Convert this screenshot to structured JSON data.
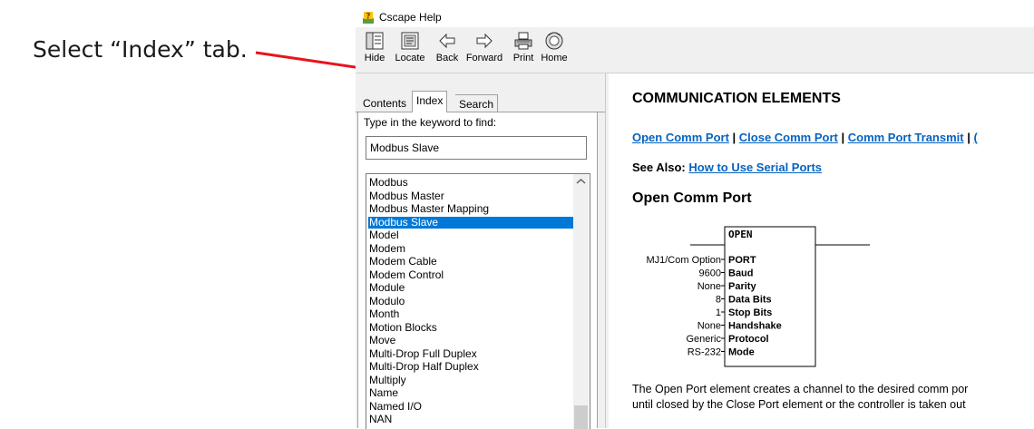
{
  "annotation": {
    "instruction": "Select “Index” tab.",
    "arrow_color": "#e8141b"
  },
  "window": {
    "title": "Cscape Help",
    "icon": "help-question-icon"
  },
  "toolbar": {
    "buttons": [
      {
        "label": "Hide",
        "icon": "hide-pane-icon"
      },
      {
        "label": "Locate",
        "icon": "locate-icon"
      },
      {
        "label": "Back",
        "icon": "back-arrow-icon"
      },
      {
        "label": "Forward",
        "icon": "forward-arrow-icon"
      },
      {
        "label": "Print",
        "icon": "print-icon"
      },
      {
        "label": "Home",
        "icon": "home-icon"
      }
    ]
  },
  "nav": {
    "tabs": [
      {
        "label": "Contents"
      },
      {
        "label": "Index",
        "active": true
      },
      {
        "label": "Search"
      }
    ],
    "keyword_label": "Type in the keyword to find:",
    "keyword_value": "Modbus Slave",
    "selected_index": 3,
    "items": [
      "Modbus",
      "Modbus Master",
      "Modbus Master Mapping",
      "Modbus Slave",
      "Model",
      "Modem",
      "Modem Cable",
      "Modem Control",
      "Module",
      "Modulo",
      "Month",
      "Motion Blocks",
      "Move",
      "Multi-Drop Full Duplex",
      "Multi-Drop Half Duplex",
      "Multiply",
      "Name",
      "Named I/O",
      "NAN"
    ],
    "selection_color": "#0078d7"
  },
  "content": {
    "heading": "COMMUNICATION ELEMENTS",
    "links": [
      "Open Comm Port",
      "Close Comm Port",
      "Comm  Port Transmit",
      "("
    ],
    "link_separator": " | ",
    "see_also_label": "See Also:",
    "see_also_link": "How to Use Serial Ports",
    "link_color": "#0563c1",
    "section_heading": "Open Comm Port",
    "block": {
      "title": "OPEN",
      "rows": [
        {
          "left": "MJ1/Com Option",
          "right": "PORT"
        },
        {
          "left": "9600",
          "right": "Baud"
        },
        {
          "left": "None",
          "right": "Parity"
        },
        {
          "left": "8",
          "right": "Data Bits"
        },
        {
          "left": "1",
          "right": "Stop Bits"
        },
        {
          "left": "None",
          "right": "Handshake"
        },
        {
          "left": "Generic",
          "right": "Protocol"
        },
        {
          "left": "RS-232",
          "right": "Mode"
        }
      ]
    },
    "paragraph_lines": [
      "The Open Port element creates a channel to the desired comm por",
      "until closed by the Close Port element or the controller is taken out"
    ]
  }
}
